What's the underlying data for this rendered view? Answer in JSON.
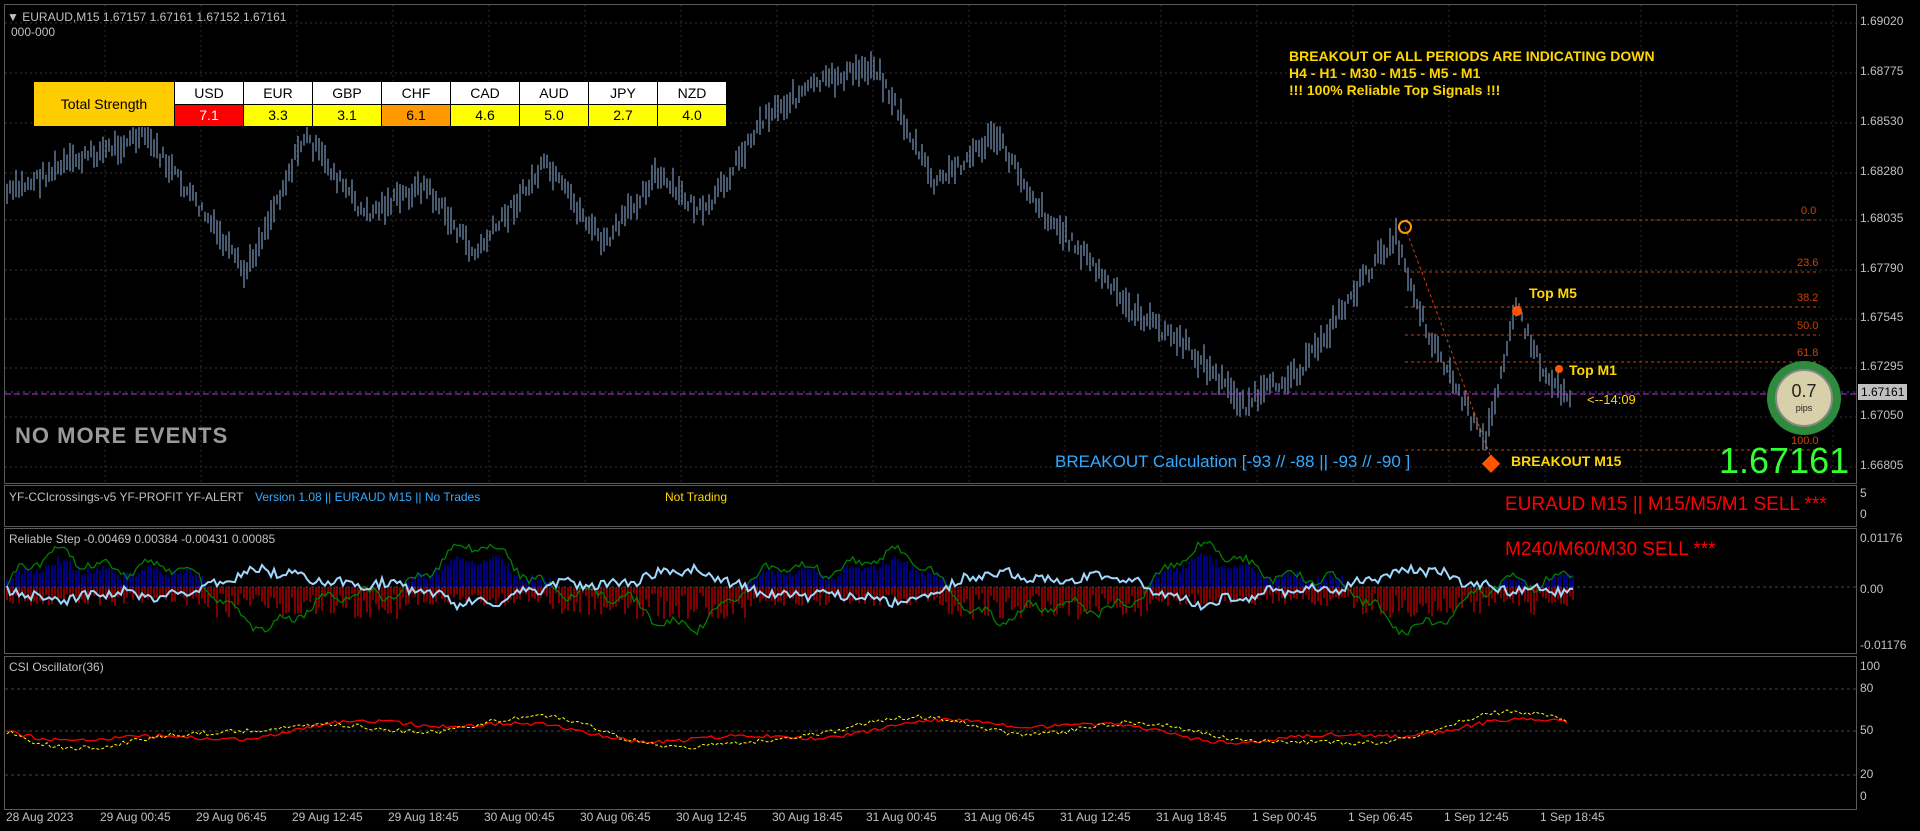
{
  "header": {
    "symbol_info": "EURAUD,M15  1.67157 1.67161 1.67152 1.67161",
    "sub": "000-000"
  },
  "strength": {
    "title": "Total Strength",
    "currencies": [
      "USD",
      "EUR",
      "GBP",
      "CHF",
      "CAD",
      "AUD",
      "JPY",
      "NZD"
    ],
    "values": [
      "7.1",
      "3.3",
      "3.1",
      "6.1",
      "4.6",
      "5.0",
      "2.7",
      "4.0"
    ],
    "colors": [
      "#ff0000",
      "#ffff00",
      "#ffff00",
      "#ff9900",
      "#ffff00",
      "#ffff00",
      "#ffff00",
      "#ffff00"
    ],
    "title_color": "#ffcc00"
  },
  "breakout_msg": {
    "line1": "BREAKOUT OF ALL PERIODS ARE INDICATING DOWN",
    "line2": "H4 - H1 - M30 - M15 - M5 - M1",
    "line3": "!!! 100% Reliable Top Signals !!!"
  },
  "fib": [
    "0.0",
    "23.6",
    "38.2",
    "50.0",
    "61.8",
    "100.0"
  ],
  "labels": {
    "top_m5": "Top M5",
    "top_m1": "Top M1",
    "breakout_m15": "BREAKOUT M15",
    "countdown": "<--14:09",
    "no_events": "NO MORE EVENTS",
    "calc": "BREAKOUT Calculation [-93 // -88  || -93 // -90 ]",
    "big_price": "1.67161",
    "pips_value": "0.7",
    "pips_unit": "pips"
  },
  "price_axis": [
    "1.69020",
    "1.68775",
    "1.68530",
    "1.68280",
    "1.68035",
    "1.67790",
    "1.67545",
    "1.67295",
    "1.67161",
    "1.67050",
    "1.66805"
  ],
  "cci_pane": {
    "names": "YF-CCIcrossings-v5  YF-PROFIT  YF-ALERT",
    "version": "Version 1.08 || EURAUD M15 || No Trades",
    "status": "Not Trading",
    "signal": "EURAUD M15 || M15/M5/M1 SELL ***",
    "axis_top": "5",
    "axis_bottom": "0"
  },
  "step_pane": {
    "title": "Reliable Step -0.00469 0.00384 -0.00431 0.00085",
    "signal": "M240/M60/M30 SELL ***",
    "axis": [
      "0.01176",
      "0.00",
      "-0.01176"
    ]
  },
  "csi_pane": {
    "title": "CSI Oscillator(36)",
    "axis": [
      "100",
      "80",
      "50",
      "20",
      "0"
    ]
  },
  "time_axis": [
    "28 Aug 2023",
    "29 Aug 00:45",
    "29 Aug 06:45",
    "29 Aug 12:45",
    "29 Aug 18:45",
    "30 Aug 00:45",
    "30 Aug 06:45",
    "30 Aug 12:45",
    "30 Aug 18:45",
    "31 Aug 00:45",
    "31 Aug 06:45",
    "31 Aug 12:45",
    "31 Aug 18:45",
    "1 Sep 00:45",
    "1 Sep 06:45",
    "1 Sep 12:45",
    "1 Sep 18:45"
  ],
  "colors": {
    "bull_bar": "#8fb4e0",
    "bear_bar": "#8fb4e0",
    "ask_line": "#cc33cc",
    "fib_line": "#cc4400",
    "signal_red": "#ff0000",
    "accent_yellow": "#ffd700",
    "big_price": "#33ff33",
    "step_blue": "#0000ff",
    "step_red": "#ff0000",
    "step_green": "#008000",
    "step_light": "#a0d8ff",
    "csi_red": "#ff0000",
    "csi_yellow": "#ffff00"
  }
}
